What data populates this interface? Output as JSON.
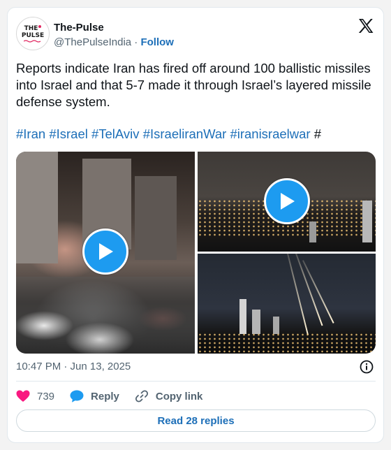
{
  "author": {
    "avatar_line1": "THE",
    "avatar_line2": "PULSE",
    "name": "The-Pulse",
    "handle": "@ThePulseIndia",
    "separator": "·",
    "follow_label": "Follow"
  },
  "platform_icon": "x-logo-icon",
  "tweet": {
    "text": "Reports indicate Iran has fired off around 100 ballistic missiles into Israel and that 5-7 made it through Israel’s layered missile defense system.",
    "hashtags": [
      "#Iran",
      "#Israel",
      "#TelAviv",
      "#IsraeliranWar",
      "#iranisraelwar"
    ],
    "trailing": "#"
  },
  "media": {
    "tiles": [
      {
        "name": "video-thumbnail-rubble",
        "icon": "play-icon"
      },
      {
        "name": "video-thumbnail-city-night",
        "icon": "play-icon"
      },
      {
        "name": "image-missile-interceptions",
        "icon": null
      }
    ]
  },
  "meta": {
    "timestamp": "10:47 PM · Jun 13, 2025",
    "info_icon": "info-icon"
  },
  "actions": {
    "like_count": "739",
    "reply_label": "Reply",
    "copy_label": "Copy link"
  },
  "read_replies_label": "Read 28 replies",
  "colors": {
    "link": "#1d6fb8",
    "heart": "#f91880",
    "play": "#1d9bf0"
  }
}
